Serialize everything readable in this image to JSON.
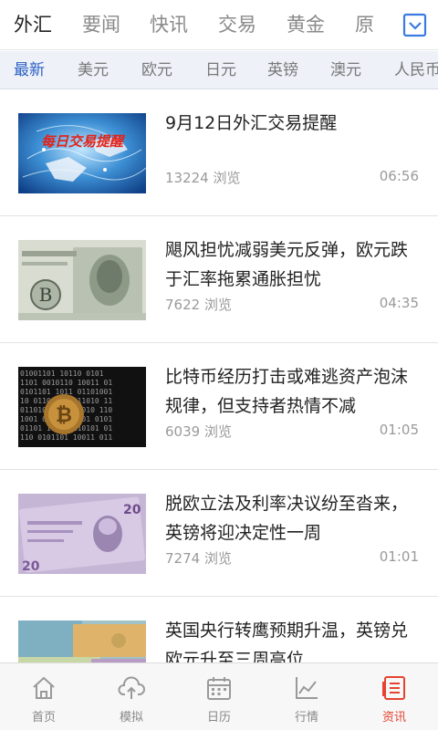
{
  "top_tabs": [
    {
      "label": "外汇",
      "active": true
    },
    {
      "label": "要闻",
      "active": false
    },
    {
      "label": "快讯",
      "active": false
    },
    {
      "label": "交易",
      "active": false
    },
    {
      "label": "黄金",
      "active": false
    },
    {
      "label": "原",
      "active": false
    }
  ],
  "more_icon": "dropdown-checkbox-icon",
  "sub_tabs": [
    {
      "label": "最新",
      "active": true
    },
    {
      "label": "美元",
      "active": false
    },
    {
      "label": "欧元",
      "active": false
    },
    {
      "label": "日元",
      "active": false
    },
    {
      "label": "英镑",
      "active": false
    },
    {
      "label": "澳元",
      "active": false
    },
    {
      "label": "人民币",
      "active": false
    }
  ],
  "news": [
    {
      "title": "9月12日外汇交易提醒",
      "views": "13224 浏览",
      "time": "06:56",
      "thumb_text": "每日交易提醒"
    },
    {
      "title": "飓风担忧减弱美元反弹，欧元跌于汇率拖累通胀担忧",
      "views": "7622 浏览",
      "time": "04:35"
    },
    {
      "title": "比特币经历打击或难逃资产泡沫规律，但支持者热情不减",
      "views": "6039 浏览",
      "time": "01:05"
    },
    {
      "title": "脱欧立法及利率决议纷至沓来，英镑将迎决定性一周",
      "views": "7274 浏览",
      "time": "01:01"
    },
    {
      "title": "英国央行转鹰预期升温，英镑兑欧元升至三周高位",
      "views": "",
      "time": ""
    }
  ],
  "bottom_tabs": [
    {
      "label": "首页",
      "icon": "home-icon"
    },
    {
      "label": "模拟",
      "icon": "cloud-upload-icon"
    },
    {
      "label": "日历",
      "icon": "calendar-icon"
    },
    {
      "label": "行情",
      "icon": "chart-line-icon"
    },
    {
      "label": "资讯",
      "icon": "news-icon",
      "active": true
    }
  ],
  "colors": {
    "accent_blue": "#2a61c6",
    "accent_red": "#e5432f"
  }
}
